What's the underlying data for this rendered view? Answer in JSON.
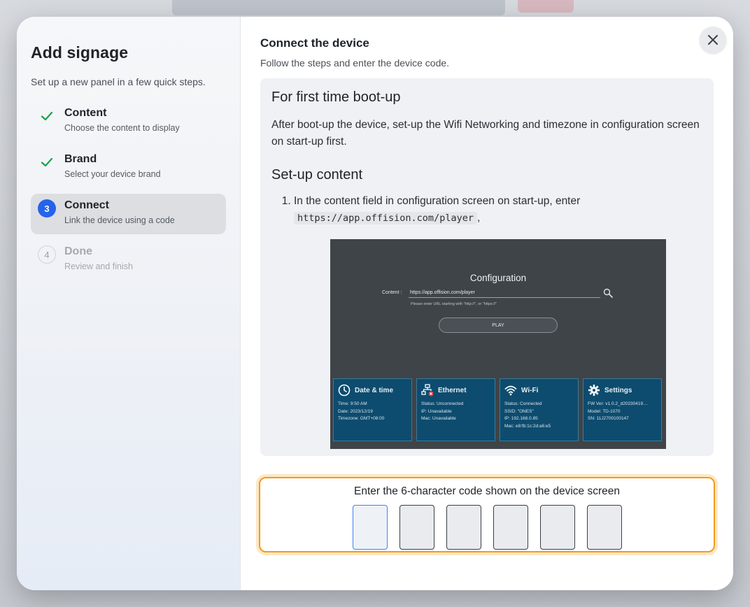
{
  "sidebar": {
    "title": "Add signage",
    "subtitle": "Set up a new panel in a few quick steps.",
    "steps": [
      {
        "label": "Content",
        "desc": "Choose the content to display",
        "state": "done",
        "num": "1"
      },
      {
        "label": "Brand",
        "desc": "Select your device brand",
        "state": "done",
        "num": "2"
      },
      {
        "label": "Connect",
        "desc": "Link the device using a code",
        "state": "active",
        "num": "3"
      },
      {
        "label": "Done",
        "desc": "Review and finish",
        "state": "pending",
        "num": "4"
      }
    ]
  },
  "main": {
    "title": "Connect the device",
    "subtitle": "Follow the steps and enter the device code.",
    "guide": {
      "heading1": "For first time boot-up",
      "para1": "After boot-up the device, set-up the Wifi Networking and timezone in configuration screen on start-up first.",
      "heading2": "Set-up content",
      "step1_text": "In the content field in configuration screen on start-up, enter",
      "step1_code": "https://app.offision.com/player",
      "step1_suffix": ","
    },
    "device_screen": {
      "title": "Configuration",
      "content_label": "Content :",
      "content_value": "https://app.offision.com/player",
      "hint": "Please enter URL starting with \"http://\", or \"https://\"",
      "play": "PLAY",
      "tiles": [
        {
          "title": "Date & time",
          "icon": "clock-icon",
          "lines": [
            "Time: 9:50 AM",
            "Date: 2023/12/19",
            "Timezone: GMT+08:00"
          ]
        },
        {
          "title": "Ethernet",
          "icon": "ethernet-icon",
          "lines": [
            "Status: Unconnected",
            "IP: Unavailable",
            "Mac: Unavailable"
          ]
        },
        {
          "title": "Wi-Fi",
          "icon": "wifi-icon",
          "lines": [
            "Status: Connected",
            "SSID: \"ONES\"",
            "IP: 192.168.0.85",
            "Mac: e8:fb:1c:2d:a6:e5"
          ]
        },
        {
          "title": "Settings",
          "icon": "gear-icon",
          "lines": [
            "FW Ver: v1.0.2_d20230419…",
            "Model: TD-1070",
            "SN: 11J2700100147"
          ]
        }
      ]
    },
    "code_entry": {
      "label": "Enter the 6-character code shown on the device screen",
      "cells": [
        "",
        "",
        "",
        "",
        "",
        ""
      ],
      "accent_color": "#f29b1d"
    }
  },
  "colors": {
    "primary": "#2563eb",
    "check": "#16a34a"
  }
}
